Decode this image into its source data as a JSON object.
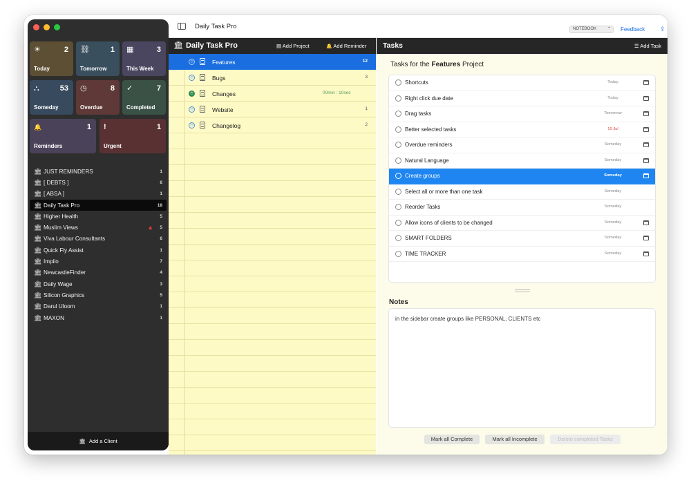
{
  "colors": {
    "red": "#ff5f57",
    "yellow": "#febc2e",
    "green": "#28c840",
    "today": "#5c4f33",
    "tomorrow": "#3a4f5e",
    "this_week": "#4b4660",
    "someday": "#384a5e",
    "overdue": "#5f3937",
    "completed": "#3a5246",
    "reminders": "#4a4259",
    "urgent": "#5a3133",
    "accent": "#1a6ee0"
  },
  "toolbar": {
    "title": "Daily Task Pro",
    "notebook": "NOTEBOOK",
    "notebook_chevron": "⌃",
    "feedback": "Feedback",
    "share_icon": "⇪"
  },
  "smart_folders": [
    {
      "label": "Today",
      "count": "2",
      "icon": "☀"
    },
    {
      "label": "Tomorrow",
      "count": "1",
      "icon": "⛓"
    },
    {
      "label": "This Week",
      "count": "3",
      "icon": "▦"
    },
    {
      "label": "Someday",
      "count": "53",
      "icon": "⛬"
    },
    {
      "label": "Overdue",
      "count": "8",
      "icon": "◷"
    },
    {
      "label": "Completed",
      "count": "7",
      "icon": "✓"
    },
    {
      "label": "Reminders",
      "count": "1",
      "icon": "🔔"
    },
    {
      "label": "Urgent",
      "count": "1",
      "icon": "!"
    }
  ],
  "clients": [
    {
      "name": "JUST REMINDERS",
      "count": "1"
    },
    {
      "name": "[ DEBTS ]",
      "count": "6"
    },
    {
      "name": "[ ABSA ]",
      "count": "1"
    },
    {
      "name": "Daily Task Pro",
      "count": "18"
    },
    {
      "name": "Higher Health",
      "count": "5"
    },
    {
      "name": "Muslim Views",
      "count": "5"
    },
    {
      "name": "Viva Labour Consultants",
      "count": "6"
    },
    {
      "name": "Quick Fly Assist",
      "count": "1"
    },
    {
      "name": "Impilo",
      "count": "7"
    },
    {
      "name": "NewcastleFinder",
      "count": "4"
    },
    {
      "name": "Daily Wage",
      "count": "3"
    },
    {
      "name": "Silicon Graphics",
      "count": "5"
    },
    {
      "name": "Darul Uloom",
      "count": "1"
    },
    {
      "name": "MAXON",
      "count": "1"
    }
  ],
  "bank_icon": "🏛",
  "warning_icon": "▲",
  "add_client": "Add a Client",
  "projects_header": {
    "title": "Daily Task Pro",
    "add_project": "Add Project",
    "add_reminder": "Add Reminder",
    "project_icon": "▤",
    "bell_icon": "🔔"
  },
  "projects": [
    {
      "name": "Features",
      "count": "12",
      "status": "◷"
    },
    {
      "name": "Bugs",
      "count": "3",
      "status": "◷"
    },
    {
      "name": "Changes",
      "count": "",
      "status": "◷",
      "time": "00min : 10sec"
    },
    {
      "name": "Website",
      "count": "1",
      "status": "◷"
    },
    {
      "name": "Changelog",
      "count": "2",
      "status": "◷"
    }
  ],
  "tasks_header": {
    "title": "Tasks",
    "add_task": "Add Task",
    "add_task_icon": "☰"
  },
  "tasks_for": {
    "prefix": "Tasks for the",
    "project": "Features",
    "suffix": "Project"
  },
  "tasks": [
    {
      "text": "Shortcuts",
      "due": "Today"
    },
    {
      "text": "Right click due date",
      "due": "Today"
    },
    {
      "text": "Drag tasks",
      "due": "Tomorrow"
    },
    {
      "text": "Better selected tasks",
      "due": "10 Jul"
    },
    {
      "text": "Overdue reminders",
      "due": "Someday"
    },
    {
      "text": "Natural Language",
      "due": "Someday"
    },
    {
      "text": "Create groups",
      "due": "Someday"
    },
    {
      "text": "Select all or more than one task",
      "due": "Someday"
    },
    {
      "text": "Reorder Tasks",
      "due": "Someday"
    },
    {
      "text": "Allow icons of clients to be changed",
      "due": "Someday"
    },
    {
      "text": "SMART FOLDERS",
      "due": "Someday"
    },
    {
      "text": "TIME TRACKER",
      "due": "Someday"
    }
  ],
  "notes": {
    "label": "Notes",
    "text": "in the sidebar create groups like PERSONAL, CLIENTS etc"
  },
  "buttons": {
    "mark_complete": "Mark all Complete",
    "mark_incomplete": "Mark all Incomplete",
    "delete_completed": "Delete completed Tasks"
  }
}
